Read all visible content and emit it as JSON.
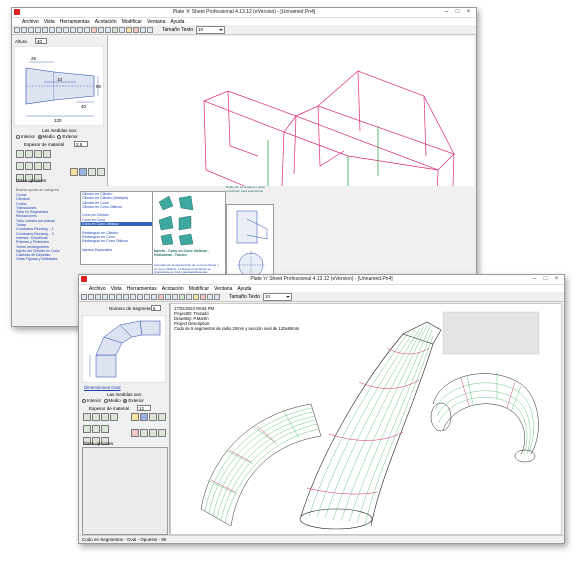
{
  "win1": {
    "title": "Plate 'n' Sheet Professional 4.13.12  (eVersion) - [Unnamed.Pn4]",
    "menu": [
      "Archivo",
      "Vista",
      "Herramientas",
      "Acotación",
      "Modificar",
      "Ventana",
      "Ayuda"
    ],
    "toolbar_label": "Tamaño Texto",
    "toolbar_value": "10",
    "param": {
      "alto_label": "Altura",
      "alto_value": "40",
      "dims": [
        "25",
        "10",
        "60",
        "40",
        "120"
      ]
    },
    "medidas_label": "Las medidas son:",
    "radios": [
      "Interior",
      "Medio",
      "Exterior"
    ],
    "espesor_label": "Espesor de material",
    "espesor_value": "2.5",
    "otras_opciones": "Otras opciones",
    "search_placeholder": "Buscar ayuda de categoría",
    "categories": [
      "Conos",
      "Cilindros",
      "Codos",
      "Transiciones",
      "Tubo en Segmentos",
      "Reducciones",
      "Tubo cortado por planos",
      "Tolvas",
      "Conductos Rectang. - 1",
      "Conductos Rectang. - 2",
      "Intersec. Cilíndricas",
      "Prismas y Pirámides",
      "Torres rectangulares",
      "Injerto del Cilindro en Codo",
      "Cabezas de Depósito",
      "Otras Figuras y Utilidades"
    ],
    "selected_category": "Cilindros",
    "items": [
      "Cilindro en Cilindro",
      "Cilindro en Cilindro (Múltiple)",
      "Cilindro en Cono",
      "Cilindro en Cono Oblicuo",
      "Cono en Cilindro",
      "Cono en Cono",
      "Cono en Cono Oblicuo",
      "Rectángulo en Cilindro",
      "Rectángulo en Cono",
      "Rectángulo en Cono Oblicuo",
      "Injertos Especiales"
    ],
    "selected_item": "Cono en Cono Oblicuo",
    "preview_title": "Injerto - Cono en Cono Oblicuo - Horizontal - Tronco",
    "preview_desc": "Formado por la intersección de un Cono Recto y un Cono Oblicuo. La Rama Cono Recto se proporciona en Cono paramétricamente.",
    "hint": "Doble clic en la figura o pulse 'Continuar' para seleccionar."
  },
  "win2": {
    "title": "Plate 'n' Sheet Professional 4.13.12  (eVersion) - [Unnamed.Pn4]",
    "menu": [
      "Archivo",
      "Vista",
      "Herramientas",
      "Acotación",
      "Modificar",
      "Ventana",
      "Ayuda"
    ],
    "toolbar_label": "Tamaño Texto",
    "toolbar_value": "10",
    "segments_label": "Número de Segmentos",
    "segments_value": "5",
    "dim_link": "Dimensiones Oval",
    "medidas_label": "Las medidas son:",
    "radios": [
      "Interior",
      "Medio",
      "Exterior"
    ],
    "espesor_label": "Espesor de material",
    "espesor_value": "12",
    "otras_opciones": "Otras opciones",
    "info": [
      "17/02/2023 08:54 PM",
      "ProjectID: Trazado",
      "DrawnBy: P.Martín",
      "Project Description:",
      "Codo de 5 segmentos de radio 20mm y sección oval de 120x60mm"
    ],
    "status": "Codo en Segmentos - Oval - Opuesto - 90"
  }
}
